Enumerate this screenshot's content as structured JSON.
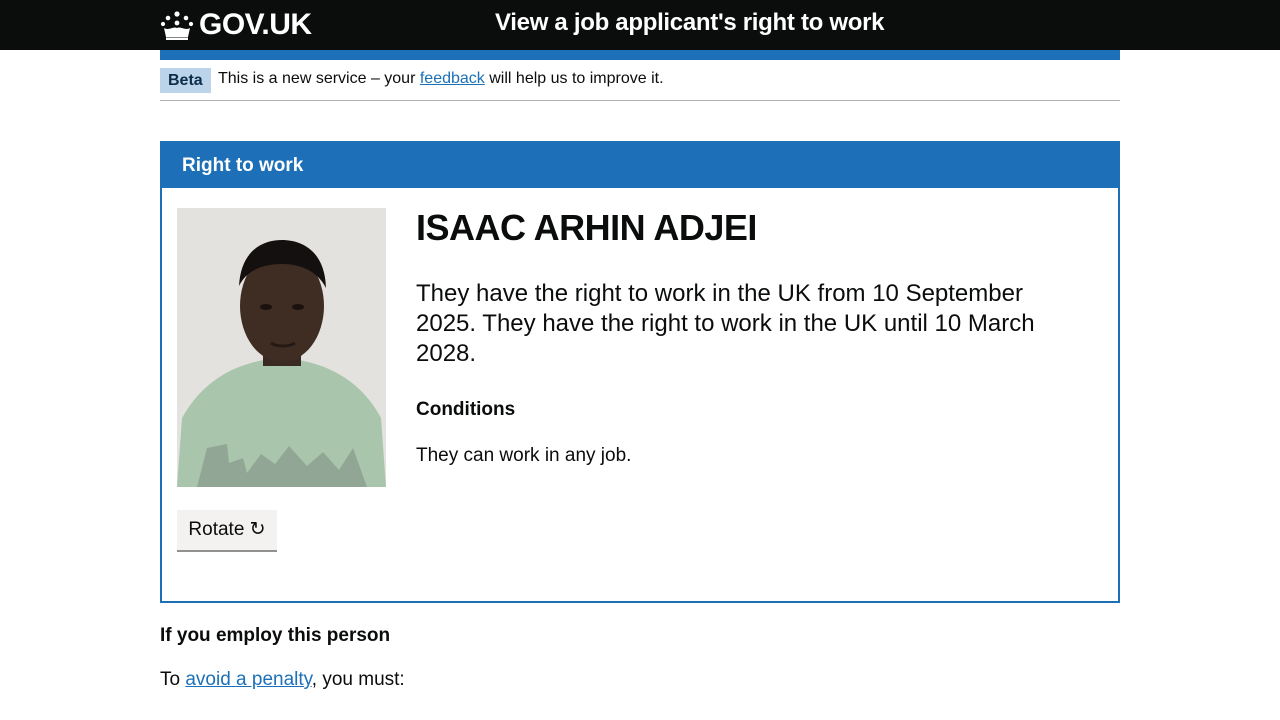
{
  "header": {
    "logo_text": "GOV.UK",
    "service_name": "View a job applicant's right to work"
  },
  "phase_banner": {
    "tag": "Beta",
    "text_before": "This is a new service – your",
    "feedback_link": "feedback",
    "text_after": "will help us to improve it."
  },
  "panel": {
    "title": "Right to work",
    "name": "ISAAC ARHIN ADJEI",
    "status": "They have the right to work in the UK from 10 September 2025. They have the right to work in the UK until 10 March 2028.",
    "conditions_heading": "Conditions",
    "conditions_text": "They can work in any job.",
    "rotate_label": "Rotate ↻"
  },
  "employ": {
    "heading": "If you employ this person",
    "penalty_before": "To",
    "penalty_link": "avoid a penalty",
    "penalty_after": ", you must:"
  },
  "colors": {
    "header_bg": "#0b0c0c",
    "brand_blue": "#1d70b8",
    "tag_bg": "#bbd4ea",
    "button_bg": "#f3f2f1"
  }
}
